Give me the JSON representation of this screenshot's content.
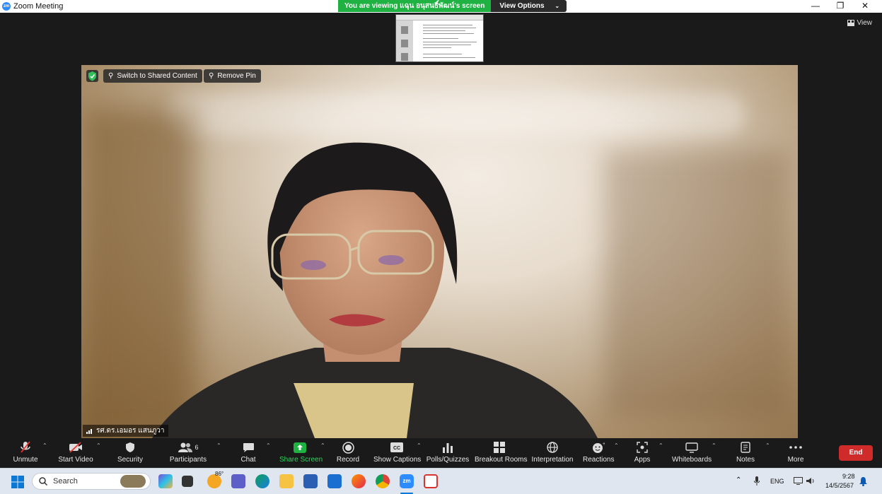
{
  "window": {
    "title": "Zoom Meeting",
    "controls": [
      "—",
      "❐",
      "✕"
    ]
  },
  "share_banner": {
    "viewing_text": "You are viewing แฉุน อนุสนธิ์พัฒน์'s screen",
    "options_label": "View Options"
  },
  "view_button": {
    "label": "View"
  },
  "video": {
    "switch_label": "Switch to Shared Content",
    "remove_pin_label": "Remove Pin",
    "participant_name": "รศ.ดร.เอมอร แสนภูวา"
  },
  "toolbar": {
    "items": [
      {
        "label": "Unmute"
      },
      {
        "label": "Start Video"
      },
      {
        "label": "Security"
      },
      {
        "label": "Participants",
        "count": "6"
      },
      {
        "label": "Chat"
      },
      {
        "label": "Share Screen"
      },
      {
        "label": "Record"
      },
      {
        "label": "Show Captions"
      },
      {
        "label": "Polls/Quizzes"
      },
      {
        "label": "Breakout Rooms"
      },
      {
        "label": "Interpretation"
      },
      {
        "label": "Reactions"
      },
      {
        "label": "Apps"
      },
      {
        "label": "Whiteboards"
      },
      {
        "label": "Notes"
      },
      {
        "label": "More"
      }
    ],
    "end_label": "End"
  },
  "taskbar": {
    "search_placeholder": "Search",
    "weather_temp": "86°",
    "language": "ENG",
    "time": "9:28",
    "date": "14/5/2567"
  },
  "colors": {
    "share_green": "#1fb141",
    "end_red": "#d02b2b",
    "zoom_blue": "#2d8cff"
  }
}
